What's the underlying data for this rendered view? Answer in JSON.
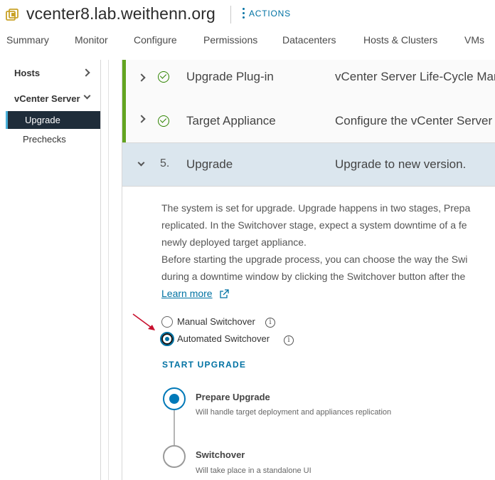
{
  "header": {
    "title": "vcenter8.lab.weithenn.org",
    "actions_label": "ACTIONS"
  },
  "tabs": [
    "Summary",
    "Monitor",
    "Configure",
    "Permissions",
    "Datacenters",
    "Hosts & Clusters",
    "VMs"
  ],
  "leftnav": {
    "hosts": "Hosts",
    "vcenter_server": "vCenter Server",
    "upgrade": "Upgrade",
    "prechecks": "Prechecks"
  },
  "steps": [
    {
      "title": "Upgrade Plug-in",
      "desc": "vCenter Server Life-Cycle Mar",
      "status": "done"
    },
    {
      "title": "Target Appliance",
      "desc": "Configure the vCenter Server",
      "status": "done"
    },
    {
      "number": "5.",
      "title": "Upgrade",
      "desc": "Upgrade to new version.",
      "status": "active"
    }
  ],
  "description_lines": [
    "The system is set for upgrade. Upgrade happens in two stages, Prepa",
    "replicated. In the Switchover stage, expect a system downtime of a fe",
    "newly deployed target appliance.",
    "Before starting the upgrade process, you can choose the way the Swi",
    "during a downtime window by clicking the Switchover button after the"
  ],
  "learn_more": "Learn more",
  "switchover_options": {
    "manual": "Manual Switchover",
    "automated": "Automated Switchover",
    "selected": "Automated Switchover",
    "info_glyph": "i"
  },
  "start_upgrade": "START UPGRADE",
  "timeline": [
    {
      "title": "Prepare Upgrade",
      "subtitle": "Will handle target deployment and appliances replication",
      "state": "active"
    },
    {
      "title": "Switchover",
      "subtitle": "Will take place in a standalone UI",
      "state": "pending"
    }
  ],
  "colors": {
    "accent": "#0072a3",
    "success_bar": "#62a420",
    "active_row": "#dbe6ee",
    "nav_active": "#1f2d3a",
    "annotation_arrow": "#c8102e"
  }
}
